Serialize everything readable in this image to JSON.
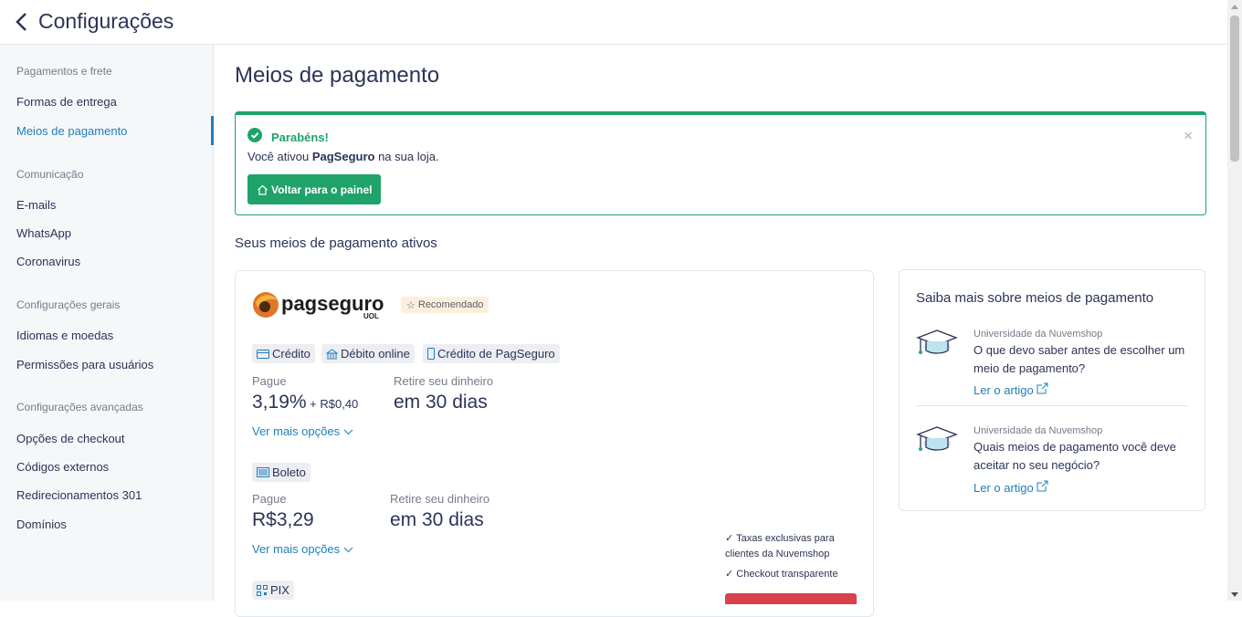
{
  "header": {
    "title": "Configurações"
  },
  "sidebar": {
    "groups": [
      {
        "heading": "Pagamentos e frete",
        "items": [
          "Formas de entrega",
          "Meios de pagamento"
        ]
      },
      {
        "heading": "Comunicação",
        "items": [
          "E-mails",
          "WhatsApp",
          "Coronavirus"
        ]
      },
      {
        "heading": "Configurações gerais",
        "items": [
          "Idiomas e moedas",
          "Permissões para usuários"
        ]
      },
      {
        "heading": "Configurações avançadas",
        "items": [
          "Opções de checkout",
          "Códigos externos",
          "Redirecionamentos 301",
          "Domínios"
        ]
      }
    ],
    "active": "Meios de pagamento"
  },
  "main": {
    "title": "Meios de pagamento",
    "alert": {
      "title": "Parabéns!",
      "msg_pre": "Você ativou ",
      "msg_bold": "PagSeguro",
      "msg_post": " na sua loja.",
      "button": "Voltar para o painel",
      "close": "×"
    },
    "subtitle": "Seus meios de pagamento ativos",
    "provider": {
      "logo_text": "pagseguro",
      "logo_sub": "UOL",
      "badge": "Recomendado",
      "card_methods": [
        "Crédito",
        "Débito online",
        "Crédito de PagSeguro"
      ],
      "card_pay_label": "Pague",
      "card_pay_value": "3,19%",
      "card_pay_extra": " + R$0,40",
      "card_withdraw_label": "Retire seu dinheiro",
      "card_withdraw_value": "em 30 dias",
      "more_options": "Ver mais opções",
      "boleto": "Boleto",
      "boleto_pay_label": "Pague",
      "boleto_pay_value": "R$3,29",
      "boleto_withdraw_label": "Retire seu dinheiro",
      "boleto_withdraw_value": "em 30 dias",
      "more_options_2": "Ver mais opções",
      "features": [
        "Taxas exclusivas para",
        "clientes da Nuvemshop",
        "Checkout transparente"
      ],
      "pix": "PIX"
    },
    "learn": {
      "title": "Saiba mais sobre meios de pagamento",
      "articles": [
        {
          "source": "Universidade da Nuvemshop",
          "q1": "O que devo saber antes de escolher um",
          "q2": "meio de pagamento?",
          "link": "Ler o artigo"
        },
        {
          "source": "Universidade da Nuvemshop",
          "q1": "Quais meios de pagamento você deve",
          "q2": "aceitar no seu negócio?",
          "link": "Ler o artigo"
        }
      ]
    }
  },
  "colors": {
    "accent": "#1e7fb9",
    "success": "#1fa36a",
    "danger": "#d9414c"
  },
  "icons": [
    "chevron-left-icon",
    "check-circle-icon",
    "close-icon",
    "home-icon",
    "star-icon",
    "credit-card-icon",
    "bank-icon",
    "phone-icon",
    "barcode-icon",
    "qr-code-icon",
    "chevron-down-icon",
    "graduation-cap-icon",
    "external-link-icon",
    "check-icon"
  ]
}
